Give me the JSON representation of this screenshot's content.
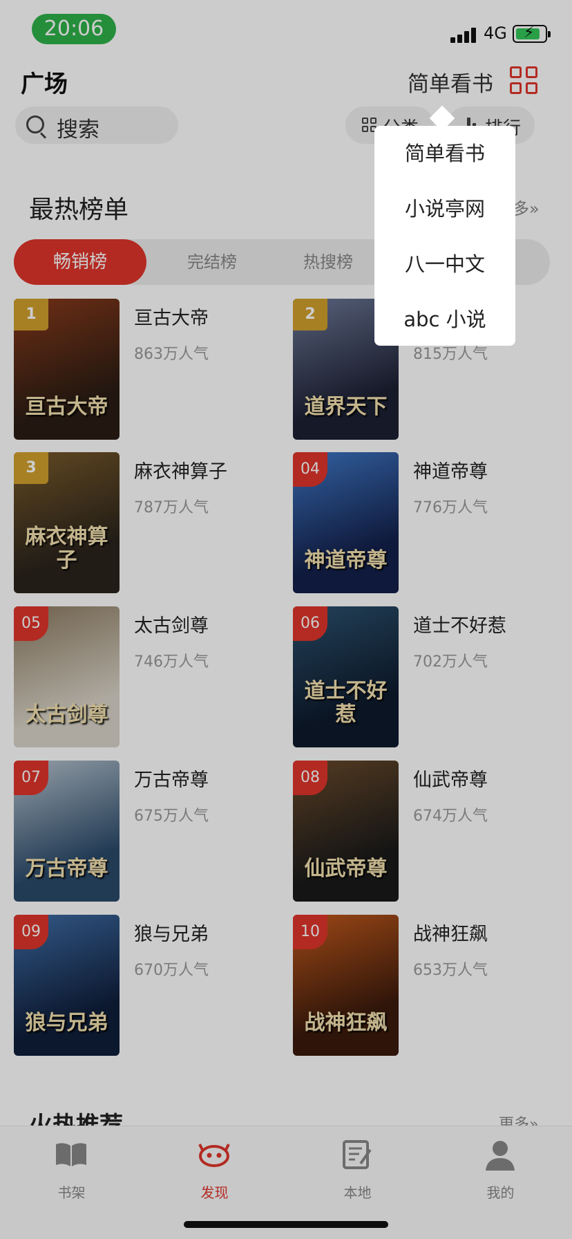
{
  "status_bar": {
    "time": "20:06",
    "network": "4G"
  },
  "header": {
    "title": "广场",
    "source_name": "简单看书"
  },
  "search": {
    "label": "搜索"
  },
  "quick_actions": {
    "category_label": "分类",
    "rank_label": "排行"
  },
  "hot_section": {
    "title": "最热榜单",
    "more": "多»"
  },
  "tabs": [
    {
      "label": "畅销榜",
      "active": true
    },
    {
      "label": "完结榜",
      "active": false
    },
    {
      "label": "热搜榜",
      "active": false
    }
  ],
  "books": [
    {
      "rank": "1",
      "title": "亘古大帝",
      "popularity": "863万人气",
      "cover_text": "亘古大帝",
      "cover_colors": [
        "#2b1d14",
        "#8a3a1a"
      ]
    },
    {
      "rank": "2",
      "title": "",
      "popularity": "815万人气",
      "cover_text": "道界天下",
      "cover_colors": [
        "#1c2033",
        "#6e7a9a"
      ]
    },
    {
      "rank": "3",
      "title": "麻衣神算子",
      "popularity": "787万人气",
      "cover_text": "麻衣神算子",
      "cover_colors": [
        "#2a241c",
        "#7a5a2a"
      ]
    },
    {
      "rank": "04",
      "title": "神道帝尊",
      "popularity": "776万人气",
      "cover_text": "神道帝尊",
      "cover_colors": [
        "#13204a",
        "#3f78c8"
      ]
    },
    {
      "rank": "05",
      "title": "太古剑尊",
      "popularity": "746万人气",
      "cover_text": "太古剑尊",
      "cover_colors": [
        "#d9d4c8",
        "#8c7a60"
      ]
    },
    {
      "rank": "06",
      "title": "道士不好惹",
      "popularity": "702万人气",
      "cover_text": "道士不好惹",
      "cover_colors": [
        "#0d1a2c",
        "#2c5270"
      ]
    },
    {
      "rank": "07",
      "title": "万古帝尊",
      "popularity": "675万人气",
      "cover_text": "万古帝尊",
      "cover_colors": [
        "#2b4a6a",
        "#b9c6d0"
      ]
    },
    {
      "rank": "08",
      "title": "仙武帝尊",
      "popularity": "674万人气",
      "cover_text": "仙武帝尊",
      "cover_colors": [
        "#1a1a1a",
        "#6a4a2a"
      ]
    },
    {
      "rank": "09",
      "title": "狼与兄弟",
      "popularity": "670万人气",
      "cover_text": "狼与兄弟",
      "cover_colors": [
        "#0f1e3a",
        "#3f6ea8"
      ]
    },
    {
      "rank": "10",
      "title": "战神狂飙",
      "popularity": "653万人气",
      "cover_text": "战神狂飙",
      "cover_colors": [
        "#3a1a0c",
        "#c45a1c"
      ]
    }
  ],
  "recommend_section": {
    "title": "火热推荐",
    "more": "更多»"
  },
  "bottom_nav": [
    {
      "label": "书架",
      "icon": "book-icon",
      "active": false
    },
    {
      "label": "发现",
      "icon": "discover-icon",
      "active": true
    },
    {
      "label": "本地",
      "icon": "local-icon",
      "active": false
    },
    {
      "label": "我的",
      "icon": "profile-icon",
      "active": false
    }
  ],
  "source_menu": {
    "items": [
      "简单看书",
      "小说亭网",
      "八一中文",
      "abc 小说"
    ]
  },
  "colors": {
    "accent": "#e0352b",
    "status_green": "#2fb24a"
  }
}
